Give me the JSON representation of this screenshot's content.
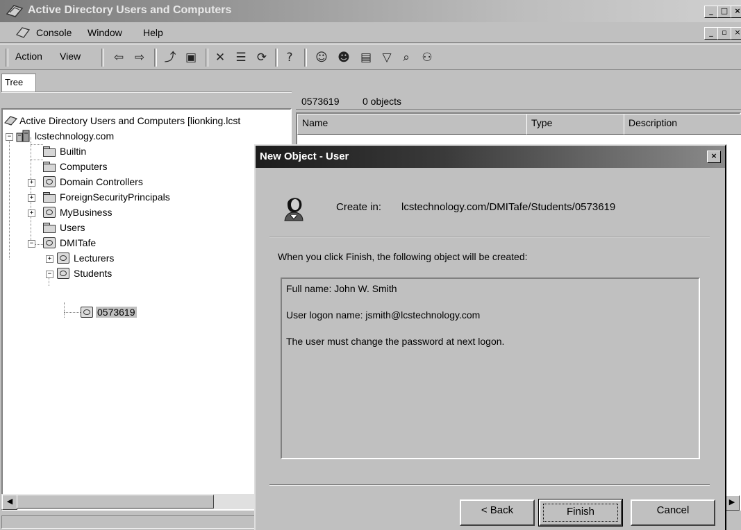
{
  "window": {
    "title": "Active Directory Users and Computers",
    "controls": [
      "_",
      "□",
      "×"
    ]
  },
  "menubar": {
    "items": [
      "Console",
      "Window",
      "Help"
    ],
    "mdi_controls": [
      "_",
      "▫",
      "×"
    ]
  },
  "toolbar": {
    "action_label": "Action",
    "view_label": "View"
  },
  "tree": {
    "tab_label": "Tree",
    "root_label": "Active Directory Users and Computers [lionking.lcst",
    "domain_label": "lcstechnology.com",
    "items": {
      "builtin": "Builtin",
      "computers": "Computers",
      "domain_controllers": "Domain Controllers",
      "foreign": "ForeignSecurityPrincipals",
      "mybusiness": "MyBusiness",
      "users": "Users",
      "dmitafe": "DMITafe",
      "lecturers": "Lecturers",
      "students": "Students",
      "selected": "0573619"
    }
  },
  "right_pane": {
    "path": "0573619",
    "count": "0 objects",
    "columns": [
      "Name",
      "Type",
      "Description"
    ]
  },
  "dialog": {
    "title": "New Object - User",
    "create_in_label": "Create in:",
    "create_in_path": "lcstechnology.com/DMITafe/Students/0573619",
    "instruction": "When you click Finish, the following object will be created:",
    "summary": [
      "Full name: John W. Smith",
      "User logon name: jsmith@lcstechnology.com",
      "The user must change the password at next logon."
    ],
    "buttons": {
      "back": "< Back",
      "finish": "Finish",
      "cancel": "Cancel"
    },
    "close": "×"
  }
}
